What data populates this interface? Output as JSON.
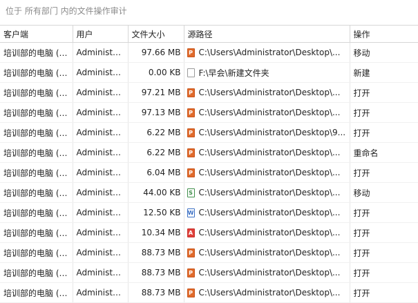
{
  "caption": "位于 所有部门 内的文件操作审计",
  "columns": [
    "客户端",
    "用户",
    "文件大小",
    "源路径",
    "操作"
  ],
  "rows": [
    {
      "client": "培训部的电脑 (1...",
      "user": "Administra...",
      "size": "97.66 MB",
      "icon": "ppt-file-icon",
      "path": "C:\\Users\\Administrator\\Desktop\\...",
      "action": "移动"
    },
    {
      "client": "培训部的电脑 (1...",
      "user": "Administra...",
      "size": "0.00 KB",
      "icon": "folder-file-icon",
      "path": "F:\\早会\\新建文件夹",
      "action": "新建"
    },
    {
      "client": "培训部的电脑 (1...",
      "user": "Administra...",
      "size": "97.21 MB",
      "icon": "ppt-file-icon",
      "path": "C:\\Users\\Administrator\\Desktop\\...",
      "action": "打开"
    },
    {
      "client": "培训部的电脑 (1...",
      "user": "Administra...",
      "size": "97.13 MB",
      "icon": "ppt-file-icon",
      "path": "C:\\Users\\Administrator\\Desktop\\...",
      "action": "打开"
    },
    {
      "client": "培训部的电脑 (1...",
      "user": "Administra...",
      "size": "6.22 MB",
      "icon": "ppt-file-icon",
      "path": "C:\\Users\\Administrator\\Desktop\\9...",
      "action": "打开"
    },
    {
      "client": "培训部的电脑 (1...",
      "user": "Administra...",
      "size": "6.22 MB",
      "icon": "ppt-file-icon",
      "path": "C:\\Users\\Administrator\\Desktop\\...",
      "action": "重命名"
    },
    {
      "client": "培训部的电脑 (1...",
      "user": "Administra...",
      "size": "6.04 MB",
      "icon": "ppt-file-icon",
      "path": "C:\\Users\\Administrator\\Desktop\\...",
      "action": "打开"
    },
    {
      "client": "培训部的电脑 (1...",
      "user": "Administra...",
      "size": "44.00 KB",
      "icon": "xls-file-icon",
      "path": "C:\\Users\\Administrator\\Desktop\\...",
      "action": "移动"
    },
    {
      "client": "培训部的电脑 (1...",
      "user": "Administra...",
      "size": "12.50 KB",
      "icon": "doc-file-icon",
      "path": "C:\\Users\\Administrator\\Desktop\\...",
      "action": "打开"
    },
    {
      "client": "培训部的电脑 (1...",
      "user": "Administra...",
      "size": "10.34 MB",
      "icon": "pdf-file-icon",
      "path": "C:\\Users\\Administrator\\Desktop\\...",
      "action": "打开"
    },
    {
      "client": "培训部的电脑 (1...",
      "user": "Administra...",
      "size": "88.73 MB",
      "icon": "ppt-file-icon",
      "path": "C:\\Users\\Administrator\\Desktop\\...",
      "action": "打开"
    },
    {
      "client": "培训部的电脑 (1...",
      "user": "Administra...",
      "size": "88.73 MB",
      "icon": "ppt-file-icon",
      "path": "C:\\Users\\Administrator\\Desktop\\...",
      "action": "打开"
    },
    {
      "client": "培训部的电脑 (1...",
      "user": "Administra...",
      "size": "88.73 MB",
      "icon": "ppt-file-icon",
      "path": "C:\\Users\\Administrator\\Desktop\\...",
      "action": "打开"
    }
  ]
}
